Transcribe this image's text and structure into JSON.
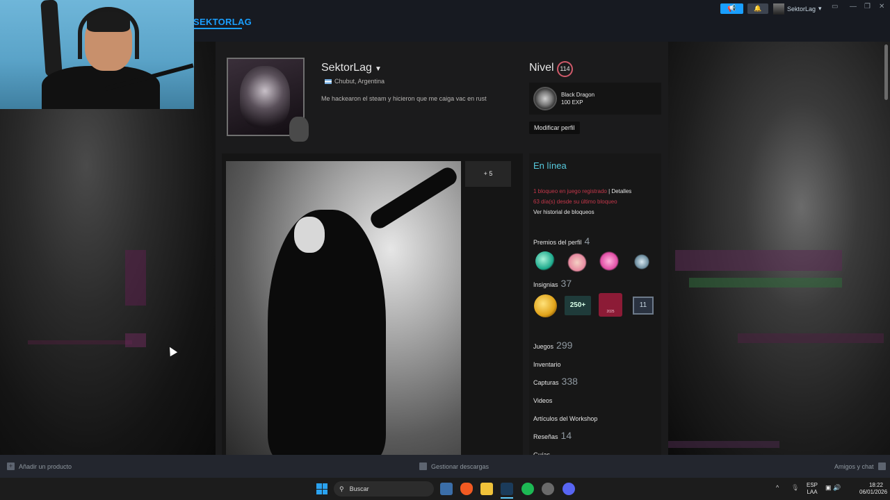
{
  "topbar": {
    "brand": "SEKTORLAG",
    "username": "SektorLag",
    "caret": "▾"
  },
  "profile": {
    "name": "SektorLag",
    "location": "Chubut, Argentina",
    "summary": "Me hackearon el steam y hicieron que me caiga vac en rust",
    "level_label": "Nivel",
    "level": "114",
    "featured_badge_name": "Black Dragon",
    "featured_badge_xp": "100 EXP",
    "edit_button": "Modificar perfil"
  },
  "showcase": {
    "more_label": "+ 5"
  },
  "sidebar": {
    "status": "En línea",
    "vac_count_text": "1 bloqueo en juego registrado",
    "vac_separator": "|",
    "vac_details": "Detalles",
    "vac_days": "63 día(s) desde su último bloqueo",
    "vac_history": "Ver historial de bloqueos",
    "awards_label": "Premios del perfil",
    "awards_count": "4",
    "badges_label": "Insignias",
    "badges_count": "37",
    "badge_250": "250+",
    "badge_year": "2025",
    "badge_11": "11",
    "games_label": "Juegos",
    "games_count": "299",
    "inventory_label": "Inventario",
    "screenshots_label": "Capturas",
    "screenshots_count": "338",
    "videos_label": "Videos",
    "workshop_label": "Artículos del Workshop",
    "reviews_label": "Reseñas",
    "reviews_count": "14",
    "guides_label": "Guías"
  },
  "bottombar": {
    "add_product": "Añadir un producto",
    "downloads": "Gestionar descargas",
    "friends_chat": "Amigos y chat"
  },
  "taskbar": {
    "search_placeholder": "Buscar",
    "lang_top": "ESP",
    "lang_bottom": "LAA",
    "time": "18:22",
    "date": "06/01/2026"
  },
  "colors": {
    "steam_blue": "#1a9fff",
    "online": "#57cbde",
    "vac_red": "#c4374a",
    "level_ring": "#d05a6a"
  },
  "icons": [
    "announcement-icon",
    "bell-icon",
    "user-avatar",
    "flag-icon",
    "dragon-icon",
    "add-icon",
    "download-icon",
    "chat-icon",
    "windows-start-icon",
    "search-icon"
  ]
}
